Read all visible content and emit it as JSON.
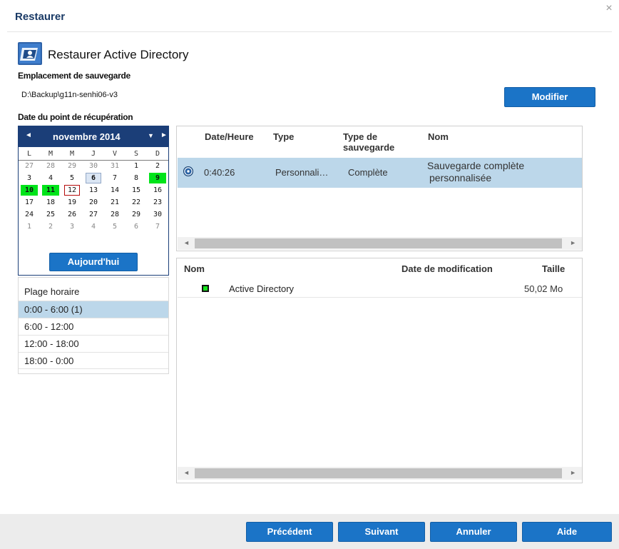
{
  "window": {
    "title": "Restaurer",
    "close_icon": "×"
  },
  "page": {
    "title": "Restaurer Active Directory"
  },
  "backup_location": {
    "label": "Emplacement de sauvegarde",
    "path": "D:\\Backup\\g11n-senhi06-v3",
    "modify_button": "Modifier"
  },
  "recovery_point": {
    "label": "Date du point de récupération",
    "calendar": {
      "month_label": "novembre 2014",
      "prev_icon": "◄",
      "next_icon": "►",
      "dropdown_icon": "▼",
      "weekdays": [
        "L",
        "M",
        "M",
        "J",
        "V",
        "S",
        "D"
      ],
      "weeks": [
        [
          {
            "d": "27",
            "t": "other"
          },
          {
            "d": "28",
            "t": "other"
          },
          {
            "d": "29",
            "t": "other"
          },
          {
            "d": "30",
            "t": "other"
          },
          {
            "d": "31",
            "t": "other"
          },
          {
            "d": "1",
            "t": ""
          },
          {
            "d": "2",
            "t": ""
          }
        ],
        [
          {
            "d": "3",
            "t": ""
          },
          {
            "d": "4",
            "t": ""
          },
          {
            "d": "5",
            "t": ""
          },
          {
            "d": "6",
            "t": "selected"
          },
          {
            "d": "7",
            "t": ""
          },
          {
            "d": "8",
            "t": ""
          },
          {
            "d": "9",
            "t": "green"
          }
        ],
        [
          {
            "d": "10",
            "t": "green"
          },
          {
            "d": "11",
            "t": "green"
          },
          {
            "d": "12",
            "t": "today"
          },
          {
            "d": "13",
            "t": ""
          },
          {
            "d": "14",
            "t": ""
          },
          {
            "d": "15",
            "t": ""
          },
          {
            "d": "16",
            "t": ""
          }
        ],
        [
          {
            "d": "17",
            "t": ""
          },
          {
            "d": "18",
            "t": ""
          },
          {
            "d": "19",
            "t": ""
          },
          {
            "d": "20",
            "t": ""
          },
          {
            "d": "21",
            "t": ""
          },
          {
            "d": "22",
            "t": ""
          },
          {
            "d": "23",
            "t": ""
          }
        ],
        [
          {
            "d": "24",
            "t": ""
          },
          {
            "d": "25",
            "t": ""
          },
          {
            "d": "26",
            "t": ""
          },
          {
            "d": "27",
            "t": ""
          },
          {
            "d": "28",
            "t": ""
          },
          {
            "d": "29",
            "t": ""
          },
          {
            "d": "30",
            "t": ""
          }
        ],
        [
          {
            "d": "1",
            "t": "other"
          },
          {
            "d": "2",
            "t": "other"
          },
          {
            "d": "3",
            "t": "other"
          },
          {
            "d": "4",
            "t": "other"
          },
          {
            "d": "5",
            "t": "other"
          },
          {
            "d": "6",
            "t": "other"
          },
          {
            "d": "7",
            "t": "other"
          }
        ]
      ],
      "today_button": "Aujourd'hui"
    }
  },
  "time_range": {
    "title": "Plage horaire",
    "items": [
      "0:00 - 6:00  (1)",
      "6:00 - 12:00",
      "12:00 - 18:00",
      "18:00 - 0:00"
    ]
  },
  "recovery_points_table": {
    "headers": {
      "datetime": "Date/Heure",
      "type": "Type",
      "backup_type_1": "Type de",
      "backup_type_2": "sauvegarde",
      "name": "Nom"
    },
    "rows": [
      {
        "time": "0:40:26",
        "type": "Personnali…",
        "backup_type": "Complète",
        "name_1": "Sauvegarde complète",
        "name_2": "personnalisée"
      }
    ]
  },
  "files_table": {
    "headers": {
      "name": "Nom",
      "modified": "Date de modification",
      "size": "Taille"
    },
    "rows": [
      {
        "name": "Active Directory",
        "modified": "",
        "size": "50,02 Mo"
      }
    ]
  },
  "footer": {
    "previous": "Précédent",
    "next": "Suivant",
    "cancel": "Annuler",
    "help": "Aide"
  },
  "colors": {
    "accent": "#1b74c7",
    "calendar_header": "#1b3e78",
    "selection": "#bcd7ea",
    "has_backup": "#00e41a"
  }
}
